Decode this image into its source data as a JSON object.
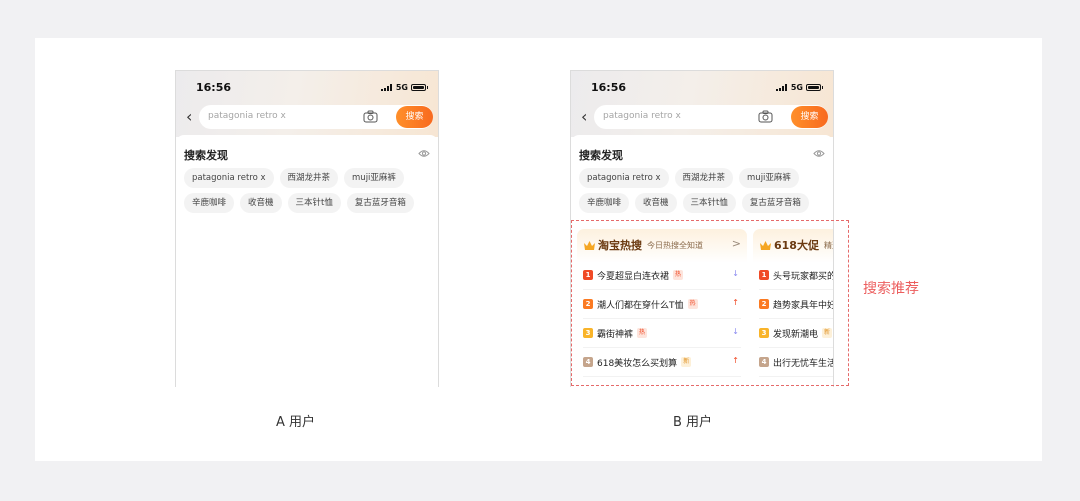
{
  "colors": {
    "accent": "#f86a1f",
    "rank1": "#f04a26",
    "rank2": "#fb7a22",
    "rank3": "#f9b42a",
    "rank4": "#c5a58c",
    "annotation": "#ec5e5e"
  },
  "screens": {
    "a": {
      "caption": "A 用户",
      "status": {
        "time": "16:56",
        "network": "5G"
      },
      "search": {
        "placeholder": "patagonia retro x",
        "button": "搜索"
      },
      "discovery": {
        "title": "搜索发现",
        "row1": [
          "patagonia retro x",
          "西湖龙井茶",
          "muji亚麻裤"
        ],
        "row2": [
          "辛鹿咖啡",
          "收音機",
          "三本针t恤",
          "复古蓝牙音箱"
        ]
      }
    },
    "b": {
      "caption": "B 用户",
      "status": {
        "time": "16:56",
        "network": "5G"
      },
      "search": {
        "placeholder": "patagonia retro x",
        "button": "搜索"
      },
      "discovery": {
        "title": "搜索发现",
        "row1": [
          "patagonia retro x",
          "西湖龙井茶",
          "muji亚麻裤"
        ],
        "row2": [
          "辛鹿咖啡",
          "收音機",
          "三本针t恤",
          "复古蓝牙音箱"
        ]
      },
      "recommend_label": "搜索推荐",
      "hot_card": {
        "title": "淘宝热搜",
        "subtitle": "今日热搜全知道",
        "arrow": ">",
        "items": [
          {
            "rank": "1",
            "text": "今夏超显白连衣裙",
            "tag": "热",
            "trend": "↓"
          },
          {
            "rank": "2",
            "text": "潮人们都在穿什么T恤",
            "tag": "热",
            "trend": "↑"
          },
          {
            "rank": "3",
            "text": "霸街神裤",
            "tag": "热",
            "trend": "↓"
          },
          {
            "rank": "4",
            "text": "618美妆怎么买划算",
            "tag": "新",
            "trend": "↑"
          }
        ]
      },
      "promo_card": {
        "title": "618大促",
        "subtitle": "精选",
        "items": [
          {
            "rank": "1",
            "text": "头号玩家都买的"
          },
          {
            "rank": "2",
            "text": "趋势家具年中好"
          },
          {
            "rank": "3",
            "text": "发现新潮电",
            "tag": "新"
          },
          {
            "rank": "4",
            "text": "出行无忧车生活"
          }
        ]
      }
    }
  }
}
